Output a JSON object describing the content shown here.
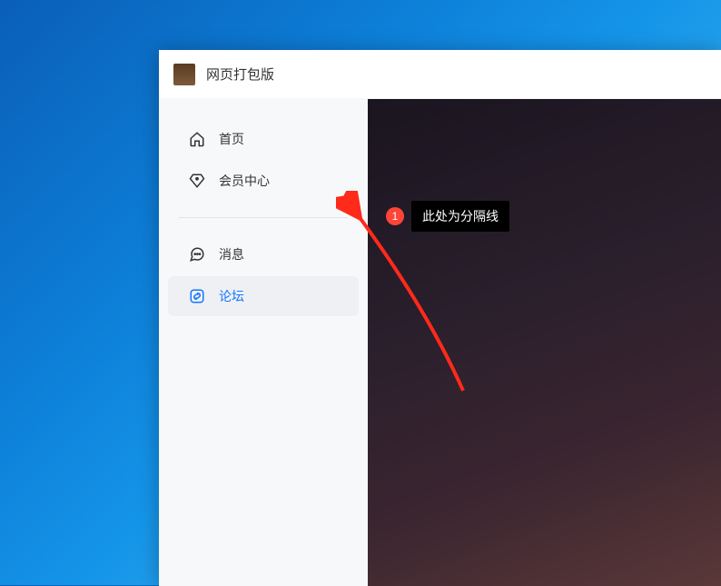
{
  "window": {
    "title": "网页打包版"
  },
  "sidebar": {
    "items": [
      {
        "label": "首页",
        "icon": "home"
      },
      {
        "label": "会员中心",
        "icon": "diamond"
      },
      {
        "label": "消息",
        "icon": "message"
      },
      {
        "label": "论坛",
        "icon": "link"
      }
    ]
  },
  "annotation": {
    "badge": "1",
    "text": "此处为分隔线"
  }
}
